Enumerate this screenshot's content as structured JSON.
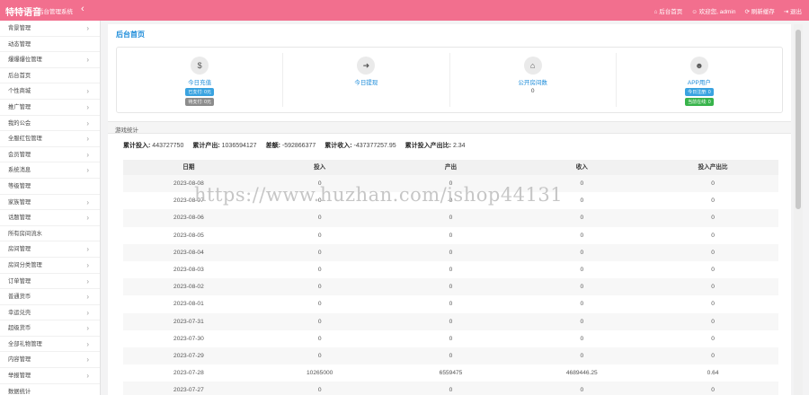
{
  "header": {
    "brand": "特特语音",
    "subtitle": "后台管理系统",
    "collapse_icon": "chevron-left-icon",
    "links": [
      {
        "icon": "home-icon",
        "label": "后台首页"
      },
      {
        "icon": "users-icon",
        "label": "欢迎您, admin"
      },
      {
        "icon": "refresh-icon",
        "label": "刷新缓存"
      },
      {
        "icon": "logout-icon",
        "label": "退出"
      }
    ]
  },
  "sidebar": {
    "items": [
      {
        "label": "背景管理",
        "chevron": "›"
      },
      {
        "label": "动态管理",
        "chevron": ""
      },
      {
        "label": "爆爆爆位管理",
        "chevron": "›"
      },
      {
        "label": "后台首页",
        "chevron": ""
      },
      {
        "label": "个性商城",
        "chevron": "›"
      },
      {
        "label": "推广管理",
        "chevron": "›"
      },
      {
        "label": "我的公会",
        "chevron": "›"
      },
      {
        "label": "全服红包管理",
        "chevron": "›"
      },
      {
        "label": "会员管理",
        "chevron": "›"
      },
      {
        "label": "系统消息",
        "chevron": "›"
      },
      {
        "label": "等级管理",
        "chevron": ""
      },
      {
        "label": "家族管理",
        "chevron": "›"
      },
      {
        "label": "话题管理",
        "chevron": "›"
      },
      {
        "label": "所有房间流水",
        "chevron": ""
      },
      {
        "label": "房间管理",
        "chevron": "›"
      },
      {
        "label": "房间分类管理",
        "chevron": "›"
      },
      {
        "label": "订单管理",
        "chevron": "›"
      },
      {
        "label": "普通货币",
        "chevron": "›"
      },
      {
        "label": "幸运兑壳",
        "chevron": "›"
      },
      {
        "label": "超级货币",
        "chevron": "›"
      },
      {
        "label": "全部礼物管理",
        "chevron": "›"
      },
      {
        "label": "内容管理",
        "chevron": "›"
      },
      {
        "label": "举报管理",
        "chevron": "›"
      },
      {
        "label": "数据统计",
        "chevron": ""
      }
    ]
  },
  "main": {
    "title": "后台首页",
    "cards": [
      {
        "icon": "money-icon",
        "label": "今日充值",
        "value": "",
        "badges": [
          {
            "text": "已支付: 0元",
            "color": "blue"
          },
          {
            "text": "待支付: 0元",
            "color": "gray"
          }
        ]
      },
      {
        "icon": "withdraw-icon",
        "label": "今日提现",
        "value": "",
        "badges": []
      },
      {
        "icon": "home-icon",
        "label": "公开房间数",
        "value": "0",
        "badges": []
      },
      {
        "icon": "user-icon",
        "label": "APP用户",
        "value": "",
        "badges": [
          {
            "text": "今日注册: 0",
            "color": "blue"
          },
          {
            "text": "当前在线: 0",
            "color": "green"
          }
        ]
      }
    ],
    "stats_title": "游戏统计",
    "summary": [
      {
        "label": "累计投入:",
        "value": "443727750"
      },
      {
        "label": "累计产出:",
        "value": "1036594127"
      },
      {
        "label": "差额:",
        "value": "-592866377"
      },
      {
        "label": "累计收入:",
        "value": "-437377257.95"
      },
      {
        "label": "累计投入产出比:",
        "value": "2.34"
      }
    ],
    "table": {
      "headers": [
        "日期",
        "投入",
        "产出",
        "收入",
        "投入产出比"
      ],
      "rows": [
        [
          "2023-08-08",
          "0",
          "0",
          "0",
          "0"
        ],
        [
          "2023-08-07",
          "0",
          "0",
          "0",
          "0"
        ],
        [
          "2023-08-06",
          "0",
          "0",
          "0",
          "0"
        ],
        [
          "2023-08-05",
          "0",
          "0",
          "0",
          "0"
        ],
        [
          "2023-08-04",
          "0",
          "0",
          "0",
          "0"
        ],
        [
          "2023-08-03",
          "0",
          "0",
          "0",
          "0"
        ],
        [
          "2023-08-02",
          "0",
          "0",
          "0",
          "0"
        ],
        [
          "2023-08-01",
          "0",
          "0",
          "0",
          "0"
        ],
        [
          "2023-07-31",
          "0",
          "0",
          "0",
          "0"
        ],
        [
          "2023-07-30",
          "0",
          "0",
          "0",
          "0"
        ],
        [
          "2023-07-29",
          "0",
          "0",
          "0",
          "0"
        ],
        [
          "2023-07-28",
          "10265000",
          "6559475",
          "4689446.25",
          "0.64"
        ],
        [
          "2023-07-27",
          "0",
          "0",
          "0",
          "0"
        ]
      ]
    },
    "watermark": "https://www.huzhan.com/ishop44131"
  },
  "colors": {
    "topbar": "#f26f8e",
    "link": "#1b8bd9",
    "badge_blue": "#3aa3e0",
    "badge_gray": "#8c8c8c",
    "badge_green": "#37b34a"
  }
}
